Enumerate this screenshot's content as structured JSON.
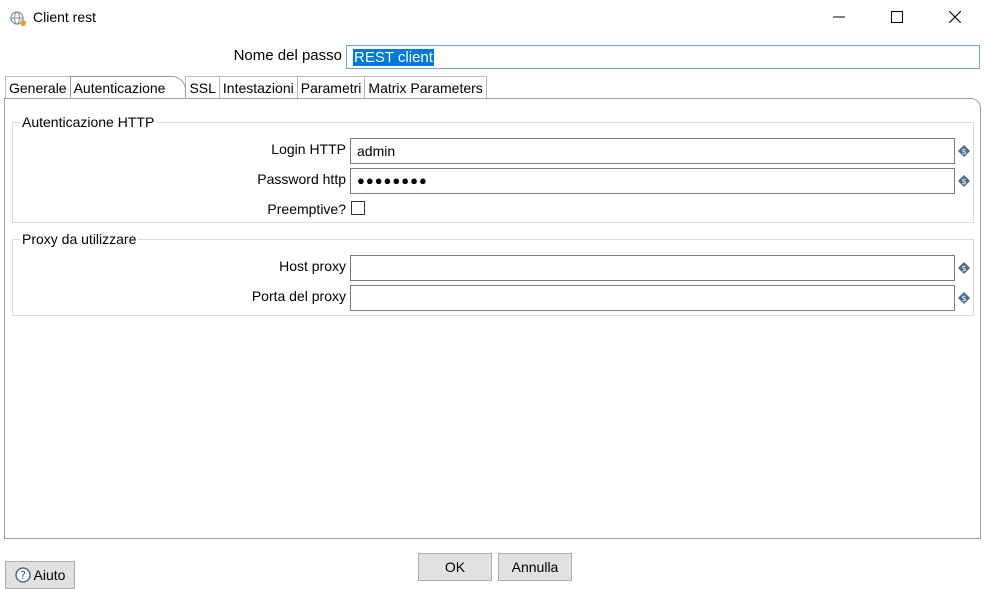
{
  "window": {
    "title": "Client rest",
    "minimize_label": "—",
    "maximize_label": "☐",
    "close_label": "✕"
  },
  "step": {
    "label": "Nome del passo",
    "value": "REST client"
  },
  "tabs": [
    {
      "label": "Generale",
      "active": false
    },
    {
      "label": "Autenticazione",
      "active": true
    },
    {
      "label": "SSL",
      "active": false
    },
    {
      "label": "Intestazioni",
      "active": false
    },
    {
      "label": "Parametri",
      "active": false
    },
    {
      "label": "Matrix Parameters",
      "active": false
    }
  ],
  "auth_group": {
    "title": "Autenticazione HTTP",
    "login_label": "Login HTTP",
    "login_value": "admin",
    "password_label": "Password http",
    "password_value": "●●●●●●●●",
    "preemptive_label": "Preemptive?",
    "preemptive_checked": false
  },
  "proxy_group": {
    "title": "Proxy da utilizzare",
    "host_label": "Host proxy",
    "host_value": "",
    "port_label": "Porta del proxy",
    "port_value": ""
  },
  "buttons": {
    "help": "Aiuto",
    "ok": "OK",
    "cancel": "Annulla"
  },
  "icons": {
    "app": "globe-rest-icon",
    "variable": "variable-diamond-icon",
    "help": "question-circle-icon"
  },
  "colors": {
    "selection": "#0078d7",
    "focus_border": "#6fa6d8",
    "variable_icon": "#4a6d8c"
  }
}
